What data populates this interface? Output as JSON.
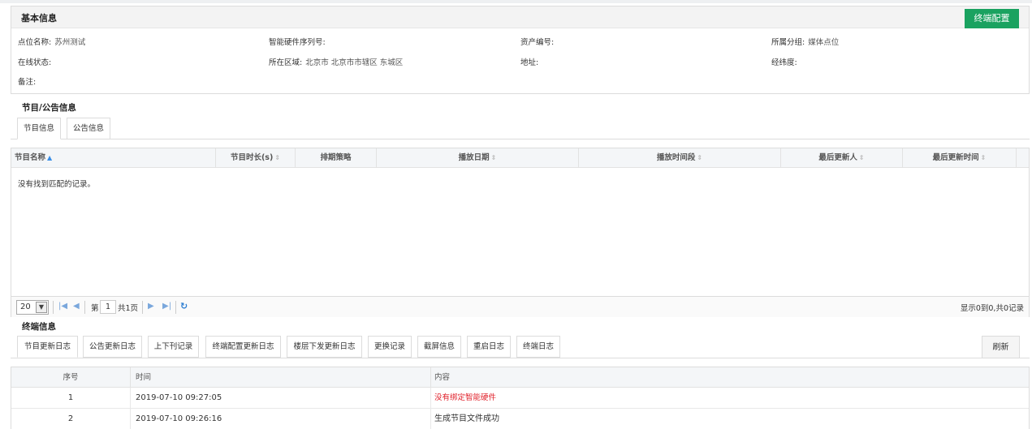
{
  "basic": {
    "title": "基本信息",
    "config_button": "终端配置",
    "fields": [
      {
        "label": "点位名称:",
        "value": "苏州测试"
      },
      {
        "label": "智能硬件序列号:",
        "value": ""
      },
      {
        "label": "资产编号:",
        "value": ""
      },
      {
        "label": "所属分组:",
        "value": "媒体点位"
      },
      {
        "label": "在线状态:",
        "value": ""
      },
      {
        "label": "所在区域:",
        "value": "北京市 北京市市辖区 东城区"
      },
      {
        "label": "地址:",
        "value": ""
      },
      {
        "label": "经纬度:",
        "value": ""
      },
      {
        "label": "备注:",
        "value": ""
      }
    ]
  },
  "program": {
    "title": "节目/公告信息",
    "tabs": [
      "节目信息",
      "公告信息"
    ],
    "columns": [
      "节目名称",
      "节目时长(s)",
      "排期策略",
      "播放日期",
      "播放时间段",
      "最后更新人",
      "最后更新时间"
    ],
    "empty_message": "没有找到匹配的记录。",
    "pager": {
      "page_size": "20",
      "page_prefix": "第",
      "page_number": "1",
      "page_total": "共1页",
      "summary": "显示0到0,共0记录"
    }
  },
  "terminal": {
    "title": "终端信息",
    "tabs": [
      "节目更新日志",
      "公告更新日志",
      "上下刊记录",
      "终端配置更新日志",
      "楼层下发更新日志",
      "更换记录",
      "截屏信息",
      "重启日志",
      "终端日志"
    ],
    "refresh_button": "刷新",
    "columns": [
      "序号",
      "时间",
      "内容"
    ],
    "rows": [
      {
        "no": "1",
        "time": "2019-07-10 09:27:05",
        "content": "没有绑定智能硬件"
      },
      {
        "no": "2",
        "time": "2019-07-10 09:26:16",
        "content": "生成节目文件成功"
      }
    ]
  },
  "colors": {
    "config_button": "#1aa260",
    "error_text": "#e0202a",
    "sort_active": "#3a8ee6"
  },
  "icons": {
    "sort_active": "sort-up-icon",
    "sort_inactive": "sort-both-icon",
    "pager": [
      "first-page-icon",
      "prev-page-icon",
      "next-page-icon",
      "last-page-icon",
      "refresh-icon"
    ]
  }
}
